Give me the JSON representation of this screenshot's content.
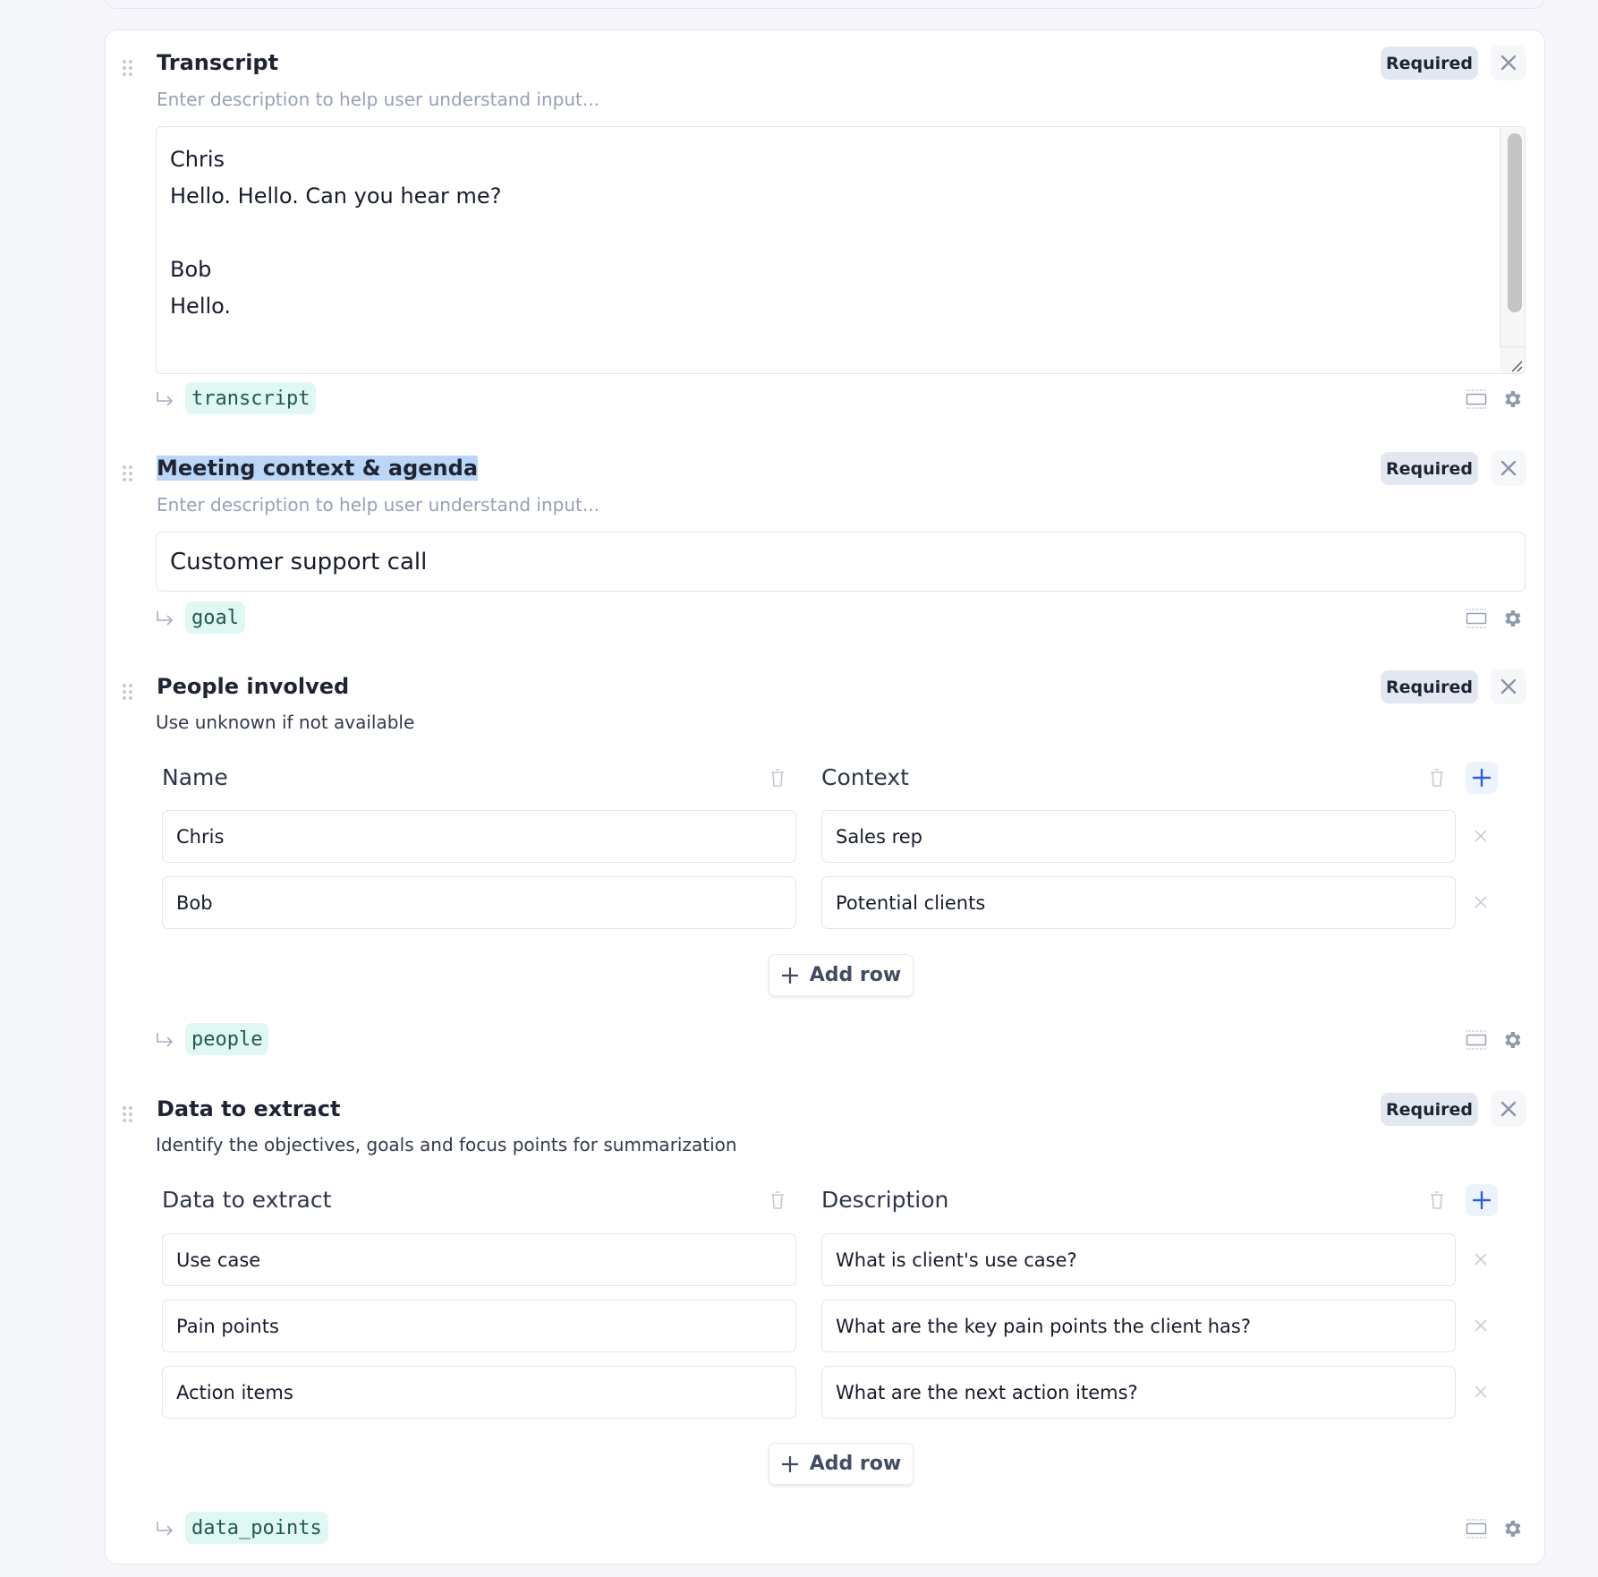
{
  "fields": {
    "transcript": {
      "title": "Transcript",
      "description_placeholder": "Enter description to help user understand input...",
      "badge": "Required",
      "value": "Chris\nHello. Hello. Can you hear me?\n\nBob\nHello.",
      "variable": "transcript"
    },
    "meeting": {
      "title": "Meeting context & agenda",
      "description_placeholder": "Enter description to help user understand input...",
      "badge": "Required",
      "value": "Customer support call",
      "variable": "goal"
    },
    "people": {
      "title": "People involved",
      "description": "Use unknown if not available",
      "badge": "Required",
      "columns": [
        "Name",
        "Context"
      ],
      "rows": [
        [
          "Chris",
          "Sales rep"
        ],
        [
          "Bob",
          "Potential clients"
        ]
      ],
      "add_row_label": "Add row",
      "variable": "people"
    },
    "data_points": {
      "title": "Data to extract",
      "description": "Identify the objectives, goals and focus points for summarization",
      "badge": "Required",
      "columns": [
        "Data to extract",
        "Description"
      ],
      "rows": [
        [
          "Use case",
          "What is client's use case?"
        ],
        [
          "Pain points",
          "What are the key pain points the client has?"
        ],
        [
          "Action items",
          "What are the next action items?"
        ]
      ],
      "add_row_label": "Add row",
      "variable": "data_points"
    }
  },
  "icons": {
    "drag": "drag-handle-icon",
    "close": "close-icon",
    "variable_arrow": "return-arrow-icon",
    "layout": "layout-icon",
    "settings": "gear-icon",
    "trash": "trash-icon",
    "plus": "plus-icon",
    "row_remove": "x-icon"
  },
  "colors": {
    "accent": "#2f5fd8",
    "badge_bg": "#e3e7ef",
    "variable_chip_bg": "#dff8f3",
    "variable_chip_text": "#245a4e",
    "selection": "#bcd6f7"
  }
}
